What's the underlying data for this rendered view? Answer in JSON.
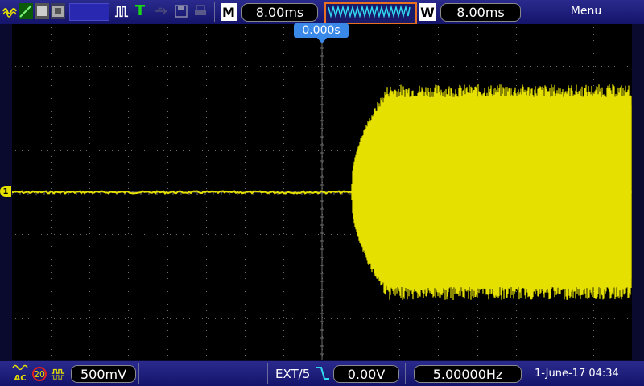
{
  "toolbar": {
    "timebase_mode_label": "M",
    "timebase_value": "8.00ms",
    "window_mode_label": "W",
    "window_value": "8.00ms",
    "wave_preview_text": "WWWWWWWW",
    "menu_label": "Menu"
  },
  "screen": {
    "trigger_time": "0.000s",
    "channel_marker": "1"
  },
  "status": {
    "coupling": "AC",
    "bandwidth_limit": "20",
    "volts_per_div": "500mV",
    "trigger_source": "EXT/5",
    "trigger_level": "0.00V",
    "frequency": "5.00000Hz",
    "datetime": "1-June-17 04:34"
  },
  "colors": {
    "trace": "#e5e000",
    "grid": "#6e6e6e",
    "bar": "#1e1e7a",
    "trigger_flag": "#3a88e8"
  }
}
